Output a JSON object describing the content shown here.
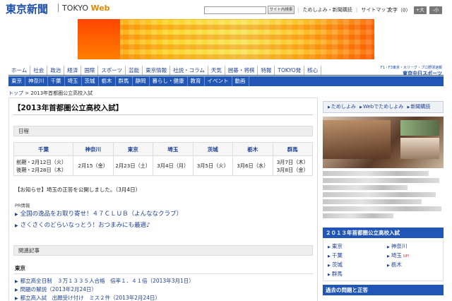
{
  "header": {
    "logo": "東京新聞",
    "logo_sub_prefix": "TOKYO ",
    "logo_sub_accent": "Web",
    "search_button": "サイト内検索",
    "links": [
      "ためしよみ・新聞購読",
      "サイトマップ"
    ],
    "font_size_label": "文字（0）",
    "font_plus": "+大",
    "font_minus": "-小"
  },
  "nav_primary": [
    "ホーム",
    "社会",
    "政治",
    "経済",
    "国際",
    "スポーツ",
    "芸能",
    "東京情報",
    "社説・コラム",
    "天気",
    "囲碁・将棋",
    "特報",
    "TOKYO発",
    "核心"
  ],
  "chunichi": {
    "small": "F1・F3東京・大リーグ・プロ野球速報",
    "name": "東京中日スポーツ"
  },
  "nav_secondary": [
    "東京",
    "神奈川",
    "千葉",
    "埼玉",
    "茨城",
    "栃木",
    "群馬",
    "静岡",
    "暮らし・健康",
    "教育",
    "イベント",
    "動画"
  ],
  "breadcrumb": {
    "home": "トップ",
    "sep": " > ",
    "current": "2013年首都圏公立高校入試"
  },
  "main": {
    "title": "【2013年首都圏公立高校入試】",
    "schedule_heading": "日程",
    "schedule": {
      "headers": [
        "千葉",
        "神奈川",
        "東京",
        "埼玉",
        "茨城",
        "栃木",
        "群馬"
      ],
      "row": [
        [
          "前期・2月12日（火）",
          "後期・2月28日（木）"
        ],
        [
          "2月15（金）"
        ],
        [
          "2月23日（土）"
        ],
        [
          "3月4日（月）"
        ],
        [
          "3月5日（火）"
        ],
        [
          "3月6日（水）"
        ],
        [
          "3月7日（木）",
          "3月8日（金）"
        ]
      ]
    },
    "notice": "【お知らせ】埼玉の正答を公開しました。（3月4日）",
    "pr_label": "PR情報",
    "pr_items": [
      "全国の逸品をお取り寄せ！４７ＣＬＵＢ（よんななクラブ）",
      "さくさくのどらいなっとう！おつまみにも最適♪"
    ],
    "related_heading": "関連記事",
    "related_sub": "東京",
    "related_items": [
      "都立高全日制　３万１３３５人合格　倍率１．４１倍（2013年3月1日）",
      "問題の解説（2013年2月24日）",
      "都立高入試　出願受け付け　ミス２件（2013年2月24日）"
    ]
  },
  "sidebar": {
    "tabs": [
      "ためしよみ",
      "Webでためしよみ",
      "新聞購読"
    ],
    "box_title": "２０１３年首都圏公立高校入試",
    "prefectures": [
      "東京",
      "神奈川",
      "千葉",
      "埼玉",
      "茨城",
      "栃木",
      "群馬"
    ],
    "up_label": "UP!",
    "past_title": "過去の問題と正答"
  }
}
